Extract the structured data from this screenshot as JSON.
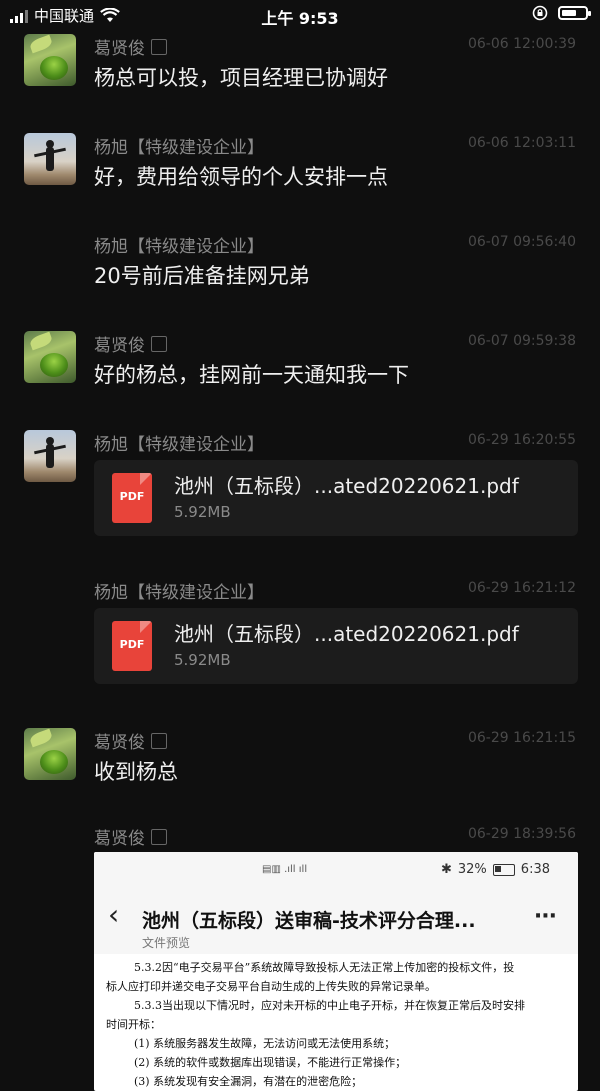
{
  "status_bar": {
    "carrier": "中国联通",
    "time": "上午 9:53"
  },
  "messages": [
    {
      "sender": "葛贤俊",
      "time": "06-06 12:00:39",
      "text": "杨总可以投，项目经理已协调好"
    },
    {
      "sender": "杨旭【特级建设企业】",
      "time": "06-06 12:03:11",
      "text": "好，费用给领导的个人安排一点"
    },
    {
      "sender": "杨旭【特级建设企业】",
      "time": "06-07 09:56:40",
      "text": "20号前后准备挂网兄弟"
    },
    {
      "sender": "葛贤俊",
      "time": "06-07 09:59:38",
      "text": "好的杨总，挂网前一天通知我一下"
    },
    {
      "sender": "杨旭【特级建设企业】",
      "time": "06-29 16:20:55",
      "file_name": "池州（五标段）...ated20220621.pdf",
      "file_size": "5.92MB",
      "file_icon": "PDF"
    },
    {
      "sender": "杨旭【特级建设企业】",
      "time": "06-29 16:21:12",
      "file_name": "池州（五标段）...ated20220621.pdf",
      "file_size": "5.92MB",
      "file_icon": "PDF"
    },
    {
      "sender": "葛贤俊",
      "time": "06-29 16:21:15",
      "text": "收到杨总"
    },
    {
      "sender": "葛贤俊",
      "time": "06-29 18:39:56"
    }
  ],
  "screenshot_image": {
    "battery": "32%",
    "time": "6:38",
    "title": "池州（五标段）送审稿-技术评分合理...",
    "subtitle": "文件预览",
    "back": "‹",
    "more": "···",
    "lines": [
      "5.3.2因“电子交易平台”系统故障导致投标人无法正常上传加密的投标文件，投",
      "标人应打印并递交电子交易平台自动生成的上传失败的异常记录单。",
      "5.3.3当出现以下情况时，应对未开标的中止电子开标，并在恢复正常后及时安排",
      "时间开标：",
      "(1)  系统服务器发生故障，无法访问或无法使用系统；",
      "(2)  系统的软件或数据库出现错误，不能进行正常操作；",
      "(3)  系统发现有安全漏洞，有潜在的泄密危险；"
    ]
  },
  "colors": {
    "background": "#0f0f0f",
    "pdf_red": "#e8443a",
    "time_gray": "#4a4a4a"
  },
  "icons": {
    "avatar_a": "matcha-tea-avatar",
    "avatar_b": "person-sunset-avatar",
    "file": "pdf-file-icon"
  }
}
